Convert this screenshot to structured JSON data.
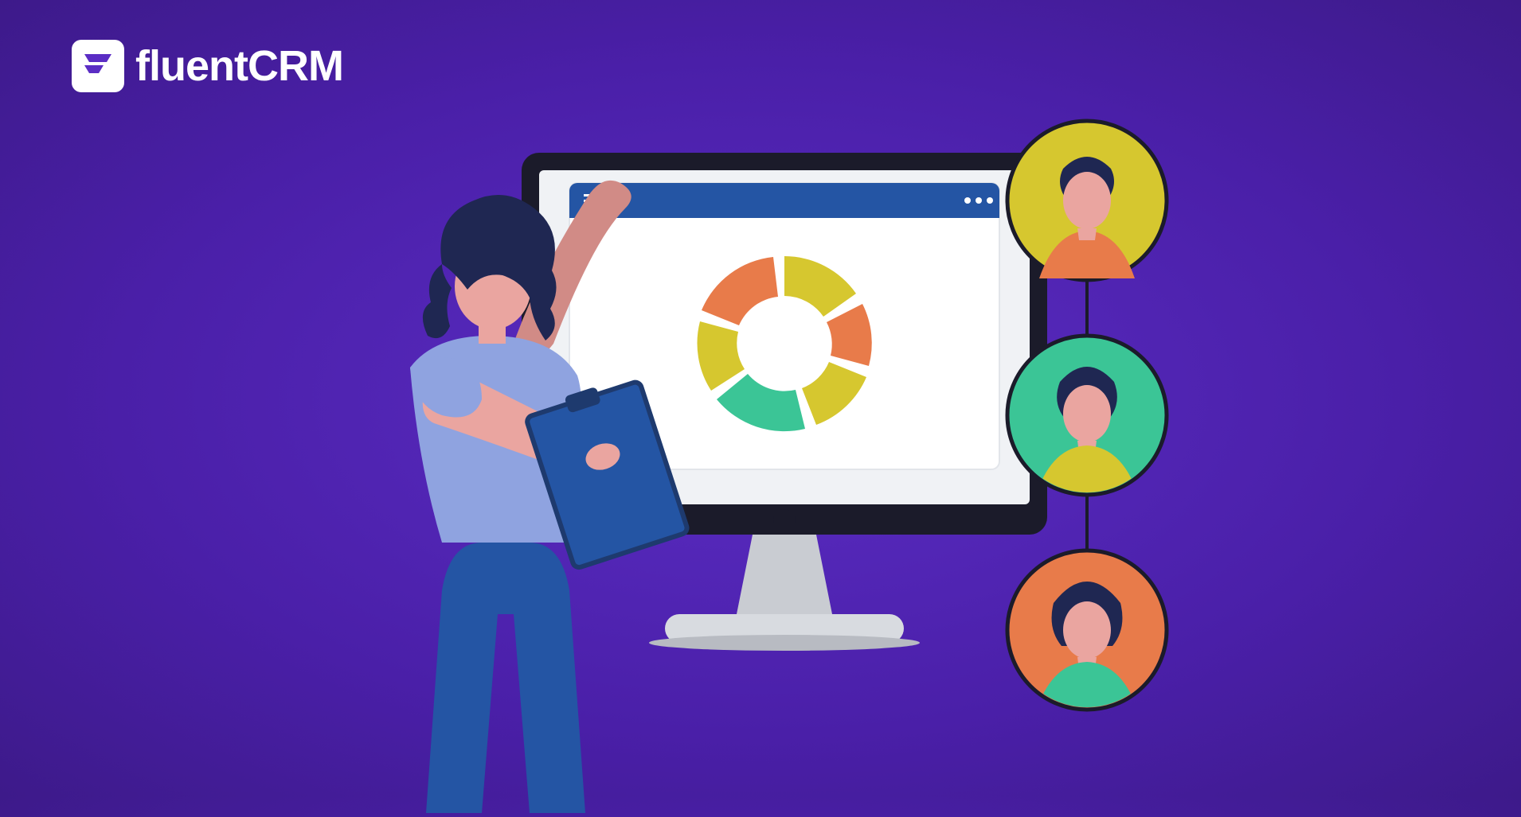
{
  "brand": {
    "name": "fluentCRM"
  },
  "colors": {
    "orange": "#e87b4a",
    "yellow": "#d6c72f",
    "teal": "#3bc596",
    "blue": "#2455a4",
    "navy": "#1e3a6e",
    "skin": "#eaa5a0",
    "skinDark": "#d18b86",
    "periwinkle": "#8fa3e0",
    "hairNavy": "#1f2752",
    "screenWhite": "#f0f2f5",
    "monitorDark": "#1b1b2a"
  }
}
